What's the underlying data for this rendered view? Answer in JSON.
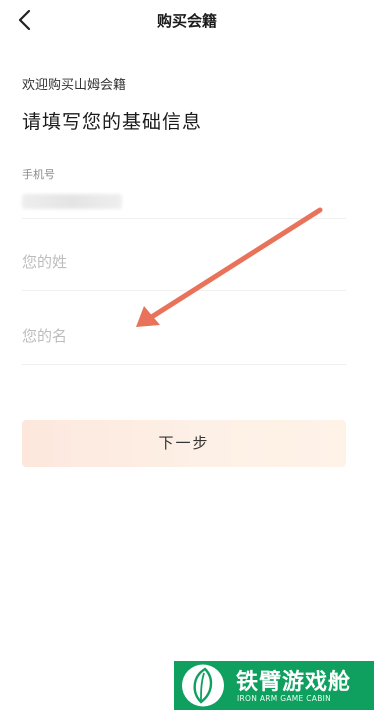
{
  "header": {
    "title": "购买会籍",
    "back_icon": "chevron-left-icon"
  },
  "welcome_text": "欢迎购买山姆会籍",
  "heading": "请填写您的基础信息",
  "phone": {
    "label": "手机号",
    "value": "",
    "note": "value blurred in screenshot"
  },
  "last_name": {
    "placeholder": "您的姓",
    "value": ""
  },
  "first_name": {
    "placeholder": "您的名",
    "value": ""
  },
  "next_button": {
    "label": "下一步"
  },
  "annotation_arrow": {
    "color": "#e8735a",
    "icon": "arrow-icon"
  },
  "watermark": {
    "title": "铁臂游戏舱",
    "subtitle": "IRON ARM GAME CABIN",
    "color": "#0fa05f",
    "icon": "leaf-logo-icon"
  }
}
